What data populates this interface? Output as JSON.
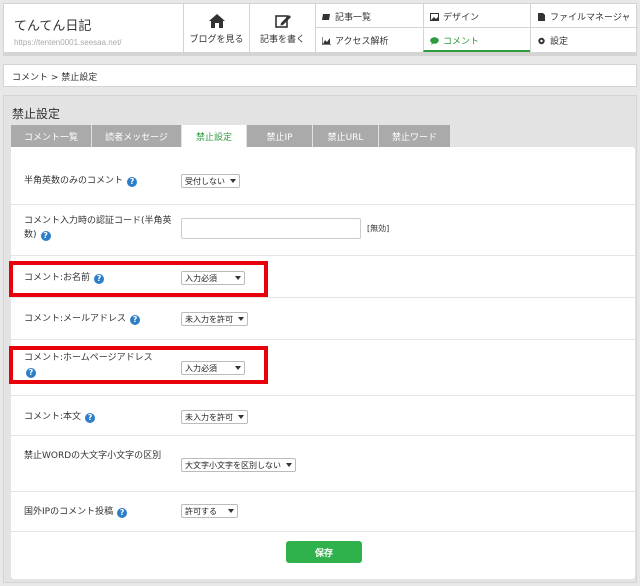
{
  "header": {
    "blog_title": "てんてん日記",
    "blog_url": "https://tenten0001.seesaa.net/",
    "view_blog_label": "ブログを見る",
    "write_post_label": "記事を書く",
    "nav": {
      "articles": "記事一覧",
      "design": "デザイン",
      "file_manager": "ファイルマネージャ",
      "access": "アクセス解析",
      "comments": "コメント",
      "settings": "設定"
    }
  },
  "breadcrumb": "コメント > 禁止設定",
  "panel": {
    "title": "禁止設定",
    "tabs": [
      "コメント一覧",
      "読者メッセージ",
      "禁止設定",
      "禁止IP",
      "禁止URL",
      "禁止ワード"
    ],
    "active_tab": "禁止設定"
  },
  "rows": [
    {
      "label": "半角英数のみのコメント",
      "value": "受付しない"
    },
    {
      "label_line1": "コメント入力時の認証コード(半角英",
      "label_line2": "数)",
      "status": "[無効]"
    },
    {
      "label": "コメント:お名前",
      "value": "入力必須"
    },
    {
      "label": "コメント:メールアドレス",
      "value": "未入力を許可"
    },
    {
      "label": "コメント:ホームページアドレス",
      "value": "入力必須"
    },
    {
      "label": "コメント:本文",
      "value": "未入力を許可"
    },
    {
      "label": "禁止WORDの大文字小文字の区別",
      "value": "大文字小文字を区別しない"
    },
    {
      "label": "国外IPのコメント投稿",
      "value": "許可する"
    }
  ],
  "save_label": "保存",
  "colors": {
    "accent": "#2e9b3f",
    "save": "#2fb24b",
    "highlight": "#e8000b",
    "help": "#2d7ec9"
  }
}
